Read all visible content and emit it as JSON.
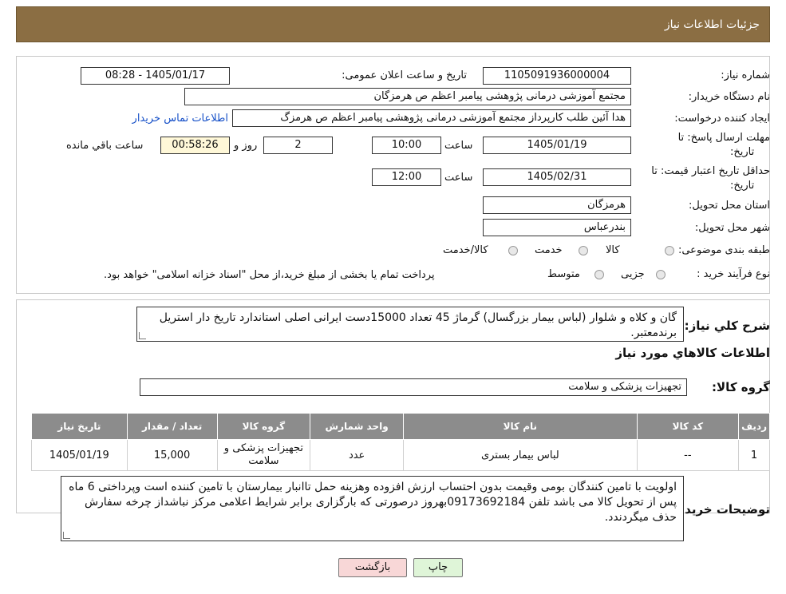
{
  "header": {
    "title": "جزئیات اطلاعات نیاز"
  },
  "form": {
    "need_number_label": "شماره نیاز:",
    "need_number": "1105091936000004",
    "announce_label": "تاریخ و ساعت اعلان عمومی:",
    "announce_value": "1405/01/17 - 08:28",
    "buyer_org_label": "نام دستگاه خریدار:",
    "buyer_org": "مجتمع آموزشی درمانی پژوهشی پیامبر اعظم ص  هرمزگان",
    "requester_label": "ایجاد کننده درخواست:",
    "requester": "هدا آئین طلب کارپرداز مجتمع آموزشی درمانی پژوهشی پیامبر اعظم ص  هرمزگ",
    "contact_link": "اطلاعات تماس خریدار",
    "deadline_label_1": "مهلت ارسال پاسخ: تا",
    "deadline_label_2": "تاریخ:",
    "deadline_date": "1405/01/19",
    "time_label": "ساعت",
    "deadline_time": "10:00",
    "days_value": "2",
    "days_label": "روز و",
    "remaining_time": "00:58:26",
    "remaining_label": "ساعت باقي مانده",
    "validity_label_1": "حداقل تاریخ اعتبار قیمت: تا",
    "validity_label_2": "تاریخ:",
    "validity_date": "1405/02/31",
    "validity_time": "12:00",
    "province_label": "استان محل تحویل:",
    "province": "هرمزگان",
    "city_label": "شهر محل تحویل:",
    "city": "بندرعباس",
    "category_label": "طبقه بندی موضوعی:",
    "category_options": [
      "کالا",
      "خدمت",
      "کالا/خدمت"
    ],
    "process_label": "نوع فرآیند خرید :",
    "process_options": [
      "جزیی",
      "متوسط"
    ],
    "process_note": "پرداخت تمام یا بخشی از مبلغ خرید،از محل \"اسناد خزانه اسلامی\" خواهد بود."
  },
  "summary": {
    "label": "شرح کلي نياز:",
    "text": "گان و کلاه و شلوار (لباس بیمار بزرگسال) گرماژ 45 تعداد 15000دست  ایرانی اصلی استاندارد تاریخ دار استریل برندمعتبر."
  },
  "goods": {
    "section_title": "اطلاعات کالاهاي مورد نياز",
    "group_label": "گروه کالا:",
    "group_value": "تجهیزات پزشکی و سلامت",
    "columns": [
      "رديف",
      "کد کالا",
      "نام کالا",
      "واحد شمارش",
      "گروه کالا",
      "تعداد / مقدار",
      "تاريخ نياز"
    ],
    "rows": [
      [
        "1",
        "--",
        "لباس بیمار بستری",
        "عدد",
        "تجهیزات پزشکی و سلامت",
        "15,000",
        "1405/01/19"
      ]
    ]
  },
  "buyer_notes": {
    "label": "توضیحات خریدار:",
    "text": "اولویت با تامین کنندگان بومی وقیمت بدون احتساب ارزش افزوده وهزینه حمل تاانبار بیمارستان با تامین کننده است وپرداختی 6 ماه پس از تحویل کالا می باشد تلفن 09173692184بهروز درصورتی که بارگزاری برابر شرایط اعلامی مرکز نباشداز چرخه سفارش حذف میگردندد."
  },
  "buttons": {
    "print": "چاپ",
    "back": "بازگشت"
  },
  "colors": {
    "header": "#8b6e43",
    "table_header": "#8c8c8c",
    "back_button": "#f8d7d7",
    "print_button": "#dff5d8",
    "remaining_bg": "#fff8d8"
  }
}
